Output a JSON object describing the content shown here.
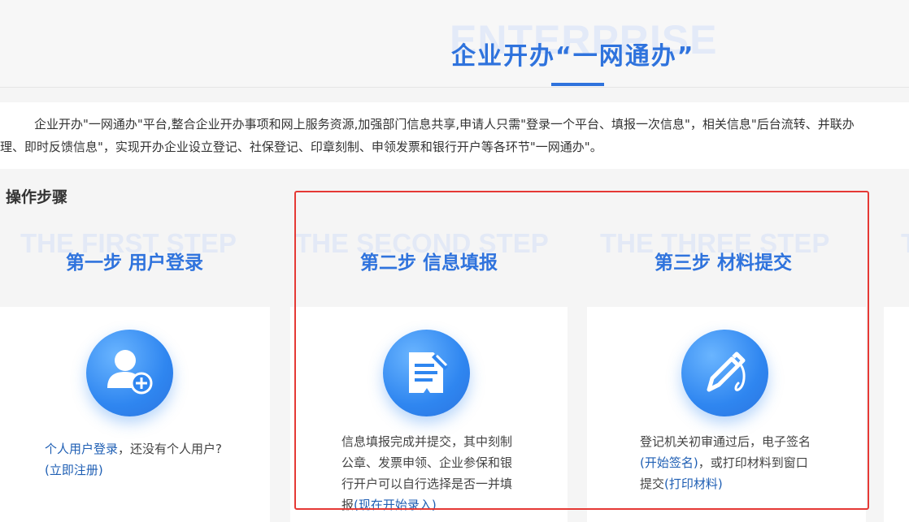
{
  "header": {
    "bg_text": "ENTERPRISE",
    "title": "企业开办“一网通办”"
  },
  "intro": {
    "line1": "企业开办\"一网通办\"平台,整合企业开办事项和网上服务资源,加强部门信息共享,申请人只需\"登录一个平台、填报一次信息\"，相关信息\"后台流转、并联办",
    "line2": "理、即时反馈信息\"，实现开办企业设立登记、社保登记、印章刻制、申领发票和银行开户等各环节\"一网通办\"。"
  },
  "steps_heading": "操作步骤",
  "steps": [
    {
      "bg_text": "THE FIRST STEP",
      "title": "第一步 用户登录",
      "icon": "user-add-icon",
      "text_pre": "",
      "link1": "个人用户登录",
      "text_mid": "，还没有个人用户?",
      "link2": "(立即注册)"
    },
    {
      "bg_text": "THE SECOND STEP",
      "title": "第二步 信息填报",
      "icon": "form-edit-icon",
      "text_pre": "信息填报完成并提交，其中刻制公章、发票申领、企业参保和银行开户可以自行选择是否一并填报",
      "link1": "(现在开始录入)"
    },
    {
      "bg_text": "THE THREE STEP",
      "title": "第三步 材料提交",
      "icon": "pen-sign-icon",
      "text_pre": "登记机关初审通过后，电子签名",
      "link1": "(开始签名)",
      "text_mid": "，或打印材料到窗口提交",
      "link2": "(打印材料)"
    }
  ],
  "colors": {
    "accent": "#2f73dd",
    "link": "#1f5fb4",
    "highlight": "#e53935"
  }
}
